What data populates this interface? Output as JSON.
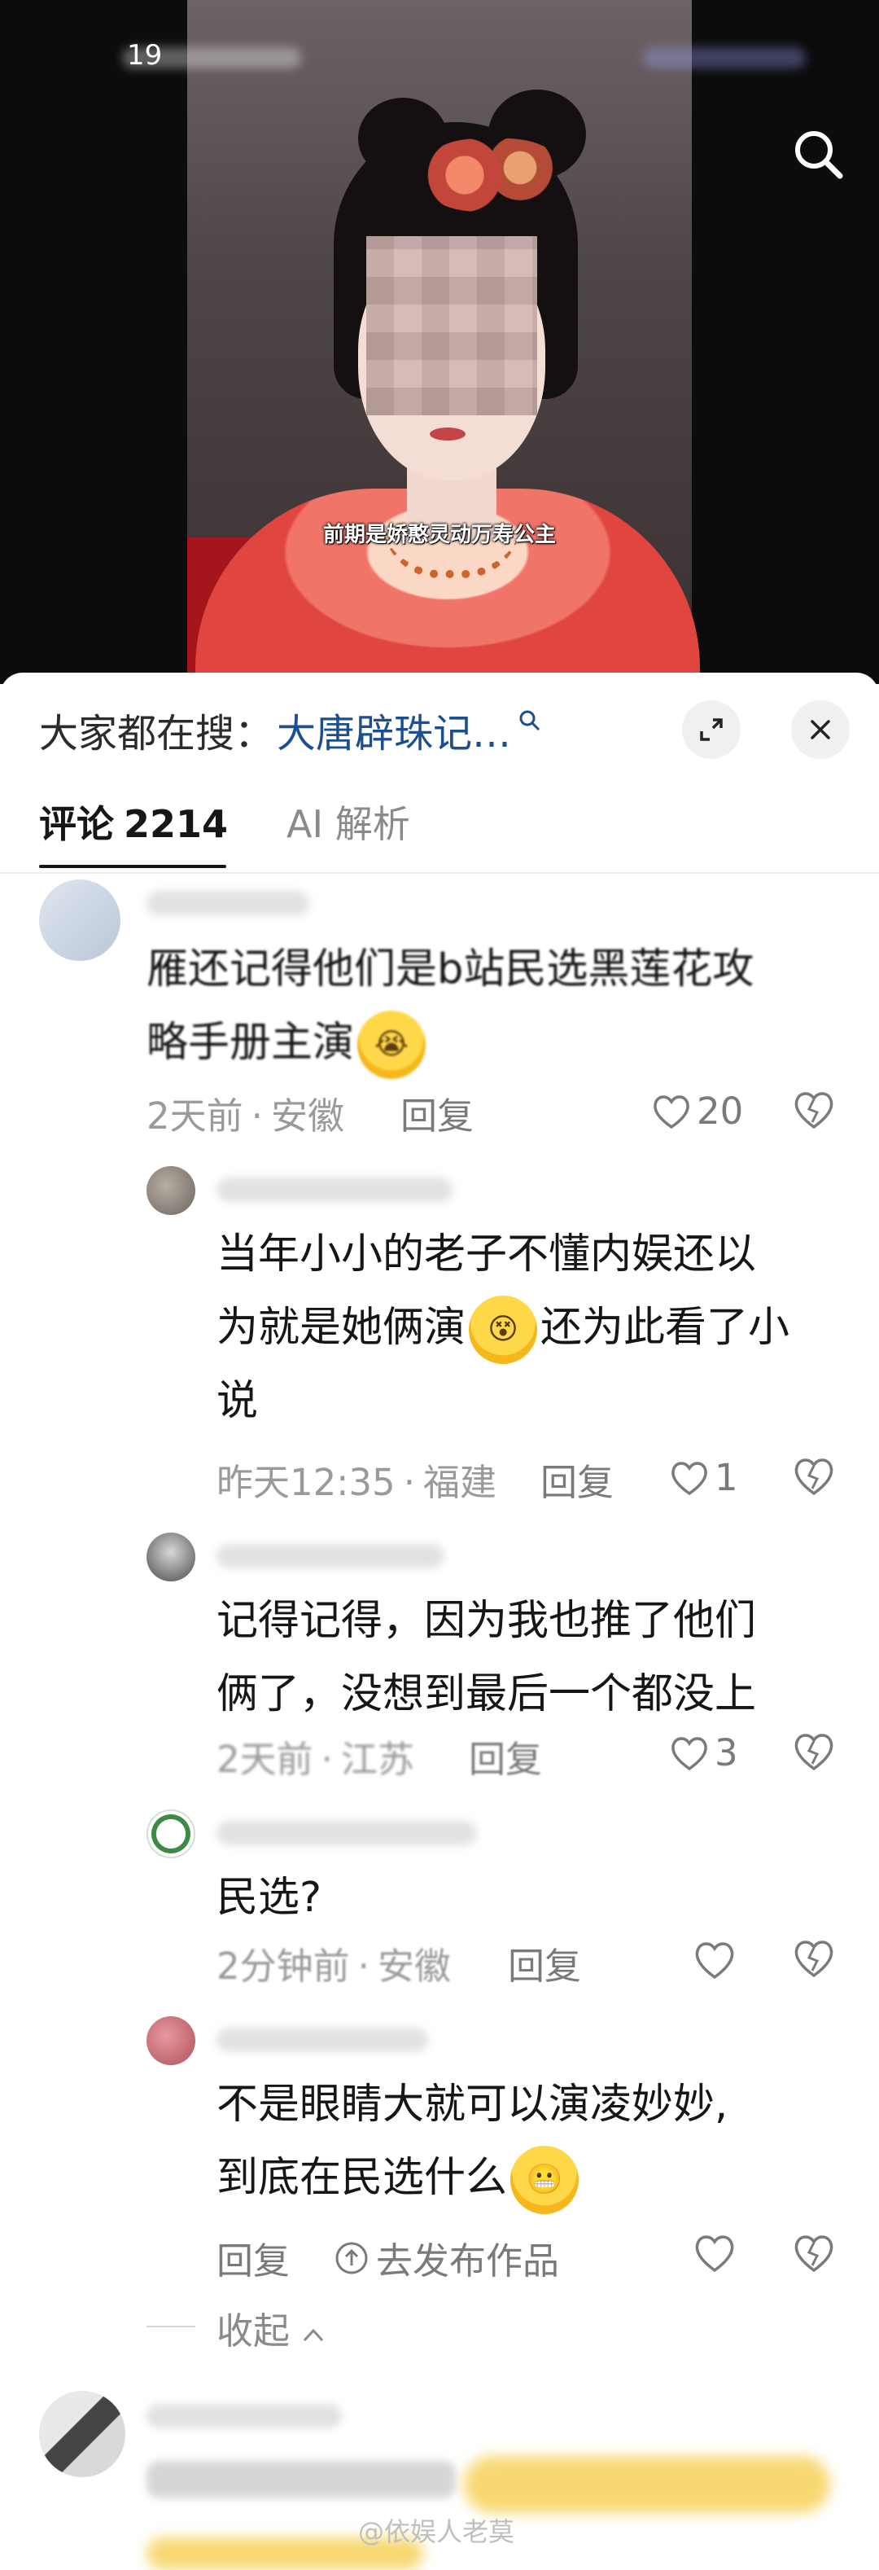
{
  "video": {
    "status_time": "19",
    "subtitle": "前期是娇憨灵动万寿公主"
  },
  "search_bar": {
    "label": "大家都在搜：",
    "term": "大唐辟珠记…"
  },
  "tabs": {
    "comments_label": "评论",
    "comments_count": "2214",
    "ai_label": "AI 解析"
  },
  "comments": [
    {
      "text_line1": "雁还记得他们是b站民选黑莲花攻",
      "text_line2": "略手册主演",
      "time": "2天前",
      "location": "安徽",
      "reply": "回复",
      "likes": "20"
    },
    {
      "text_line1": "当年小小的老子不懂内娱还以",
      "text_line2a": "为就是她俩演",
      "text_line2b": "还为此看了小",
      "text_line3": "说",
      "time": "昨天12:35",
      "location": "福建",
      "reply": "回复",
      "likes": "1"
    },
    {
      "text_line1": "记得记得，因为我也推了他们",
      "text_line2": "俩了，没想到最后一个都没上",
      "time": "2天前",
      "location": "江苏",
      "reply": "回复",
      "likes": "3"
    },
    {
      "text_line1": "民选?",
      "time": "2分钟前",
      "location": "安徽",
      "reply": "回复"
    },
    {
      "text_line1": "不是眼睛大就可以演凌妙妙,",
      "text_line2": "到底在民选什么",
      "reply": "回复",
      "publish": "去发布作品"
    }
  ],
  "collapse_label": "收起",
  "watermark": "@依娱人老莫",
  "colors": {
    "link_blue": "#1d4e8f",
    "meta_gray": "#9a9a9a"
  }
}
